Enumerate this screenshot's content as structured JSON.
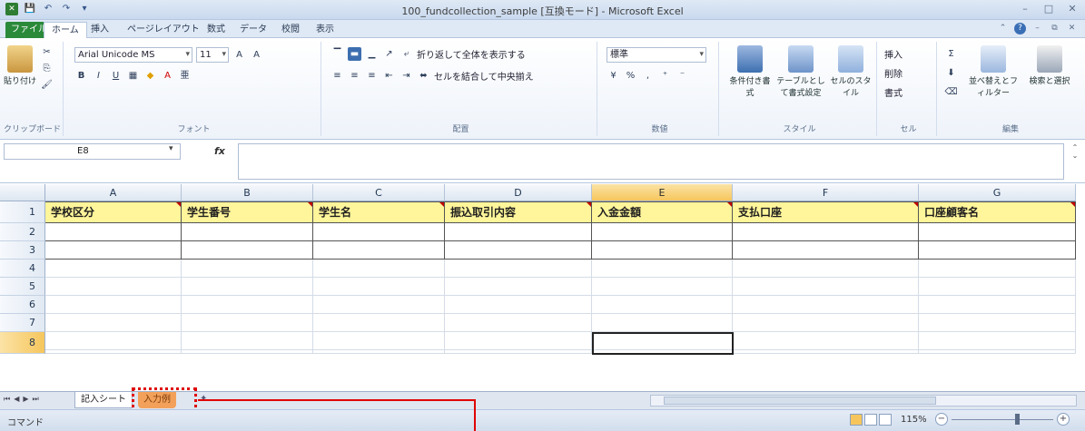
{
  "title": {
    "qat": [
      "✕",
      "💾",
      "↶",
      "↷",
      "▾"
    ],
    "window_title": "100_fundcollection_sample  [互換モード]  -  Microsoft Excel",
    "controls": [
      "–",
      "□",
      "✕"
    ]
  },
  "tabs": {
    "file": "ファイル",
    "items": [
      "ホーム",
      "挿入",
      "ページレイアウト",
      "数式",
      "データ",
      "校閲",
      "表示"
    ],
    "active_index": 0
  },
  "ribbon": {
    "clipboard": {
      "paste": "貼り付け",
      "label": "クリップボード"
    },
    "font": {
      "name": "Arial Unicode MS",
      "size": "11",
      "label": "フォント"
    },
    "alignment": {
      "wrap": "折り返して全体を表示する",
      "merge": "セルを結合して中央揃え",
      "label": "配置"
    },
    "number": {
      "format": "標準",
      "label": "数値"
    },
    "styles": {
      "cond": "条件付き書式",
      "table": "テーブルとして書式設定",
      "cell": "セルのスタイル",
      "label": "スタイル"
    },
    "cells": {
      "insert": "挿入",
      "delete": "削除",
      "format": "書式",
      "label": "セル"
    },
    "editing": {
      "sort": "並べ替えとフィルター",
      "find": "検索と選択",
      "label": "編集"
    }
  },
  "formula_bar": {
    "name_box": "E8",
    "fx": "fx",
    "content": ""
  },
  "columns": [
    "A",
    "B",
    "C",
    "D",
    "E",
    "F",
    "G"
  ],
  "selected_column": "E",
  "rows": [
    "1",
    "2",
    "3",
    "4",
    "5",
    "6",
    "7",
    "8"
  ],
  "selected_row": "8",
  "header_cells": [
    "学校区分",
    "学生番号",
    "学生名",
    "振込取引内容",
    "入金金額",
    "支払口座",
    "口座顧客名"
  ],
  "sheets": {
    "active": "記入シート",
    "other": "入力例"
  },
  "status": {
    "mode": "コマンド",
    "zoom": "115%"
  }
}
